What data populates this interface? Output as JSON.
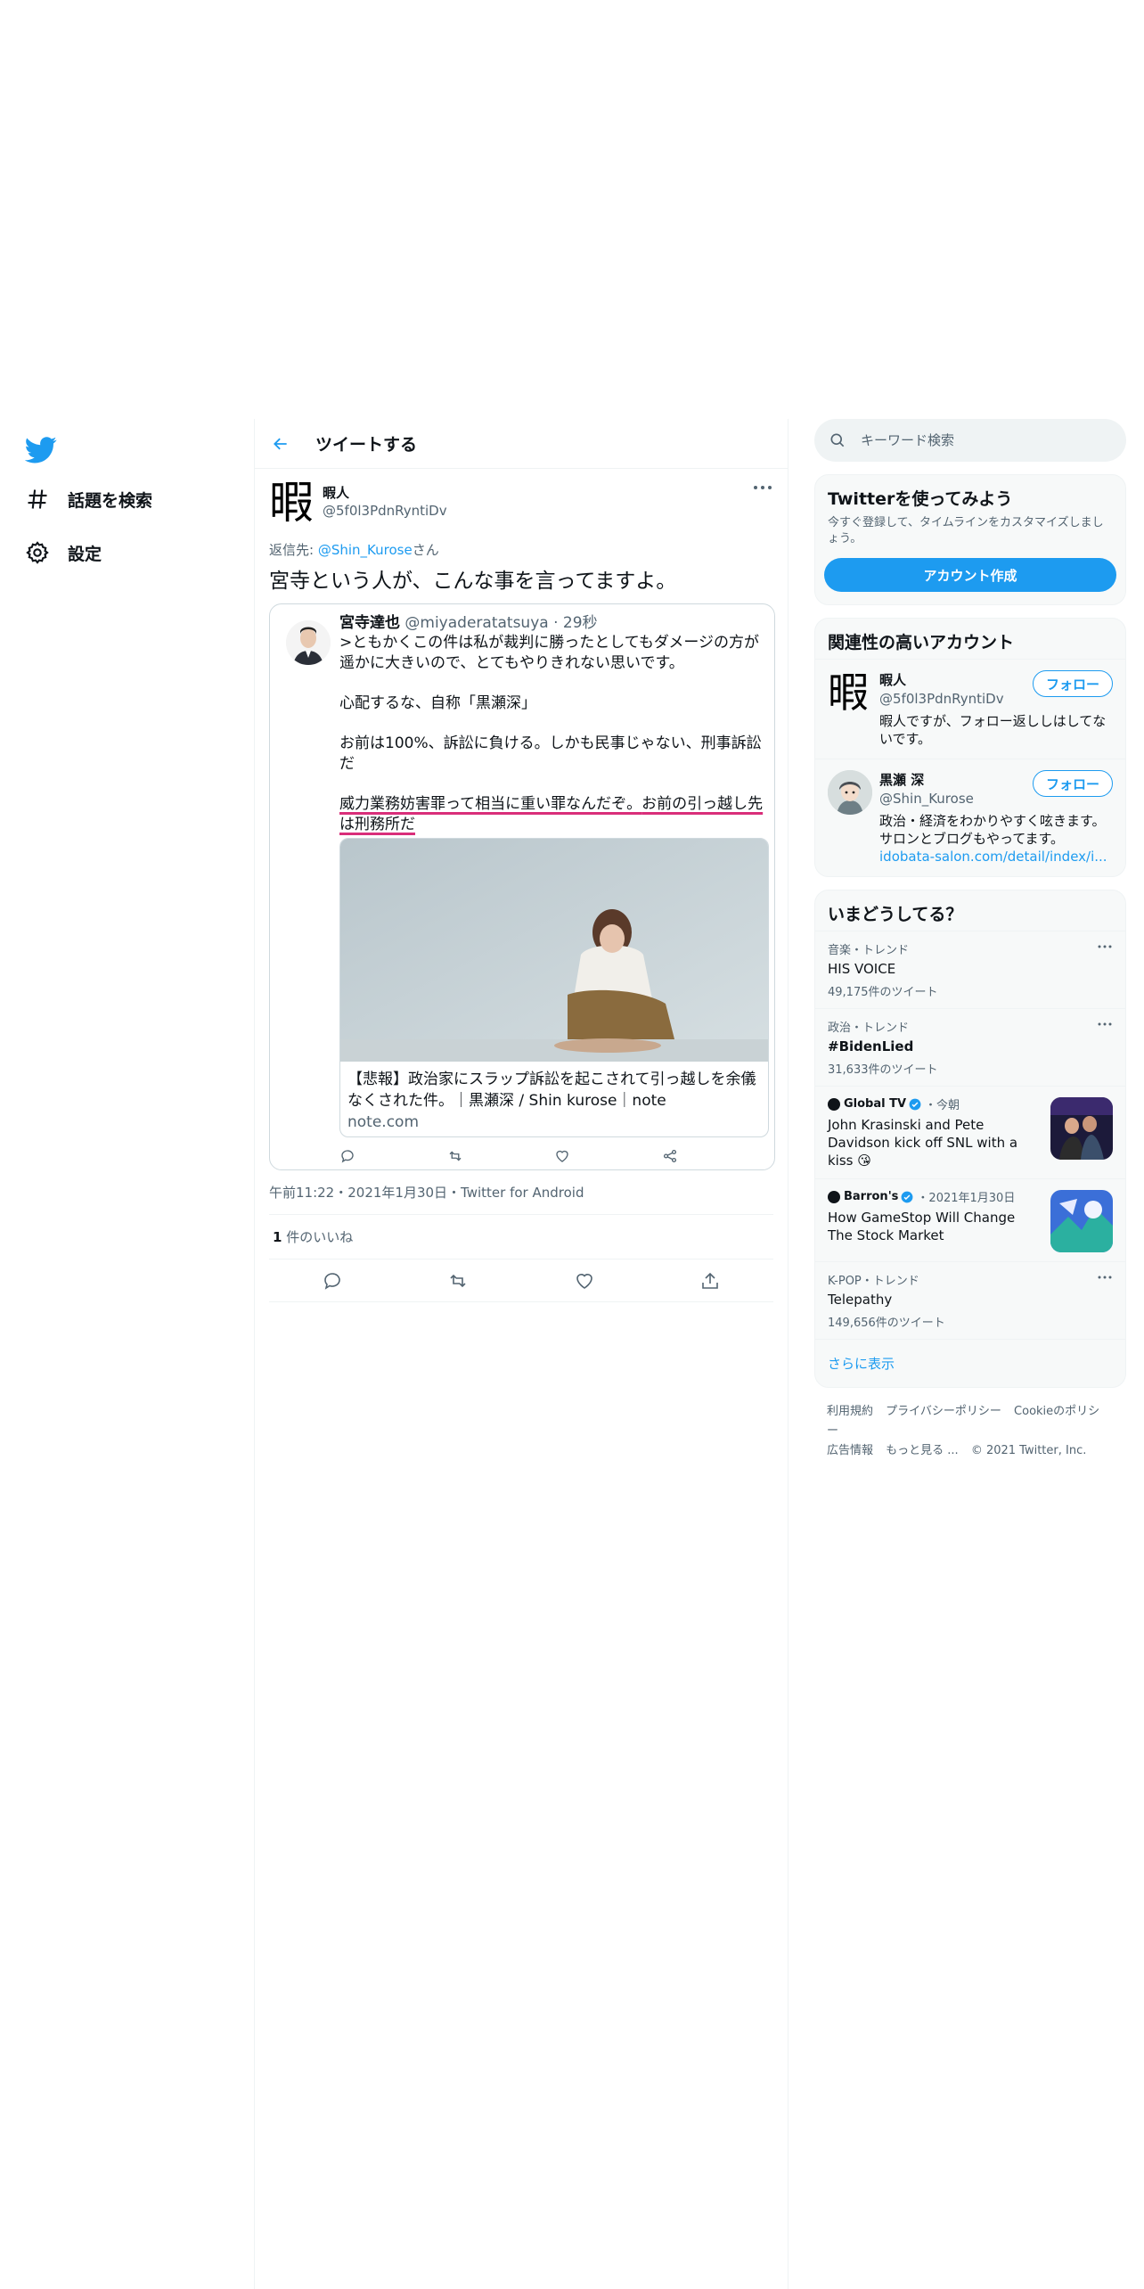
{
  "nav": {
    "explore_label": "話題を検索",
    "settings_label": "設定"
  },
  "header": {
    "title": "ツイートする"
  },
  "tweet": {
    "author_avatar_text": "暇",
    "author_name": "暇人",
    "author_handle": "@5f0l3PdnRyntiDv",
    "reply_prefix": "返信先: ",
    "reply_mention": "@Shin_Kurose",
    "reply_suffix": "さん",
    "text": "宮寺という人が、こんな事を言ってますよ。",
    "embed": {
      "name": "宮寺達也",
      "handle_time": " @miyaderatatsuya · 29秒",
      "line1": ">ともかくこの件は私が裁判に勝ったとしてもダメージの方が遥かに大きいので、とてもやりきれない思いです。",
      "line2": "心配するな、自称「黒瀬深」",
      "line3": "お前は100%、訴訟に負ける。しかも民事じゃない、刑事訴訟だ",
      "line4a": "威力業務妨害罪って相当に重い罪なんだぞ。",
      "line4b": "お前の引っ越し先は刑務所だ",
      "card_title": "【悲報】政治家にスラップ訴訟を起こされて引っ越しを余儀なくされた件。｜黒瀬深 / Shin kurose｜note",
      "card_domain": "note.com"
    },
    "timestamp": "午前11:22・2021年1月30日・Twitter for Android",
    "likes_count": "1",
    "likes_label": " 件のいいね"
  },
  "search": {
    "placeholder": "キーワード検索"
  },
  "signup": {
    "title": "Twitterを使ってみよう",
    "subtitle": "今すぐ登録して、タイムラインをカスタマイズしましょう。",
    "button": "アカウント作成"
  },
  "who_to_follow": {
    "title": "関連性の高いアカウント",
    "follow_label": "フォロー",
    "accounts": [
      {
        "avatar_text": "暇",
        "name": "暇人",
        "handle": "@5f0l3PdnRyntiDv",
        "bio": "暇人ですが、フォロー返ししはしてないです。"
      },
      {
        "name": "黒瀬 深",
        "handle": "@Shin_Kurose",
        "bio": "政治・経済をわかりやすく呟きます。サロンとブログもやってます。",
        "bio_link": "idobata-salon.com/detail/index/i..."
      }
    ]
  },
  "trends": {
    "title": "いまどうしてる？",
    "items": [
      {
        "context": "音楽・トレンド",
        "name": "HIS VOICE",
        "count": "49,175件のツイート"
      },
      {
        "context": "政治・トレンド",
        "name": "#BidenLied",
        "count": "31,633件のツイート"
      }
    ],
    "news": [
      {
        "source": "Global TV",
        "when": "・今朝",
        "title": "John Krasinski and Pete Davidson kick off SNL with a kiss 😘"
      },
      {
        "source": "Barron's",
        "when": "・2021年1月30日",
        "title": "How GameStop Will Change The Stock Market"
      }
    ],
    "last": {
      "context": "K-POP・トレンド",
      "name": "Telepathy",
      "count": "149,656件のツイート"
    },
    "show_more": "さらに表示"
  },
  "footer": {
    "terms": "利用規約",
    "privacy": "プライバシーポリシー",
    "cookie": "Cookieのポリシー",
    "ads": "広告情報",
    "more": "もっと見る ...",
    "copyright": "© 2021 Twitter, Inc."
  },
  "colors": {
    "accent": "#1d9bf0",
    "text": "#0f1419",
    "muted": "#536471",
    "underline": "#d92e7a"
  }
}
